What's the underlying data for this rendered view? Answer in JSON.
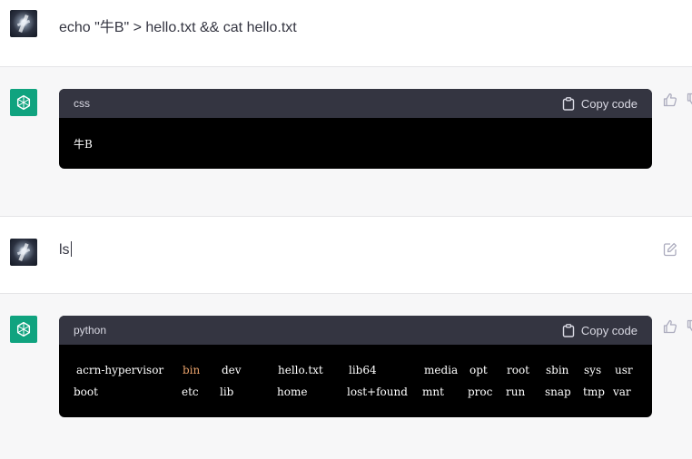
{
  "messages": {
    "m1": {
      "text": "echo \"牛B\" > hello.txt && cat hello.txt"
    },
    "m2": {
      "language": "css",
      "copy_label": "Copy code",
      "code": "牛B"
    },
    "m3": {
      "text": "ls"
    },
    "m4": {
      "language": "python",
      "copy_label": "Copy code",
      "lines": [
        [
          {
            "text": "acrn-hypervisor"
          },
          {
            "text": "bin",
            "color": "#e9a26b"
          },
          {
            "text": "dev"
          },
          {
            "text": "hello.txt"
          },
          {
            "text": "lib64"
          },
          {
            "text": "media"
          },
          {
            "text": "opt"
          },
          {
            "text": "root"
          },
          {
            "text": "sbin"
          },
          {
            "text": "sys"
          },
          {
            "text": "usr"
          }
        ],
        [
          {
            "text": "boot"
          },
          {
            "text": "etc"
          },
          {
            "text": "lib"
          },
          {
            "text": "home"
          },
          {
            "text": "lost+found"
          },
          {
            "text": "mnt"
          },
          {
            "text": "proc"
          },
          {
            "text": "run"
          },
          {
            "text": "snap"
          },
          {
            "text": "tmp"
          },
          {
            "text": "var"
          }
        ]
      ]
    }
  },
  "icons": {
    "user_avatar": "user-avatar",
    "assistant_avatar": "openai-logo-icon",
    "copy": "clipboard-icon",
    "thumbs_up": "thumbs-up-icon",
    "edit": "edit-icon"
  },
  "colors": {
    "accent": "#10a37f",
    "code_header": "#343541",
    "code_bg": "#000000",
    "assistant_row_bg": "#f7f7f8"
  }
}
